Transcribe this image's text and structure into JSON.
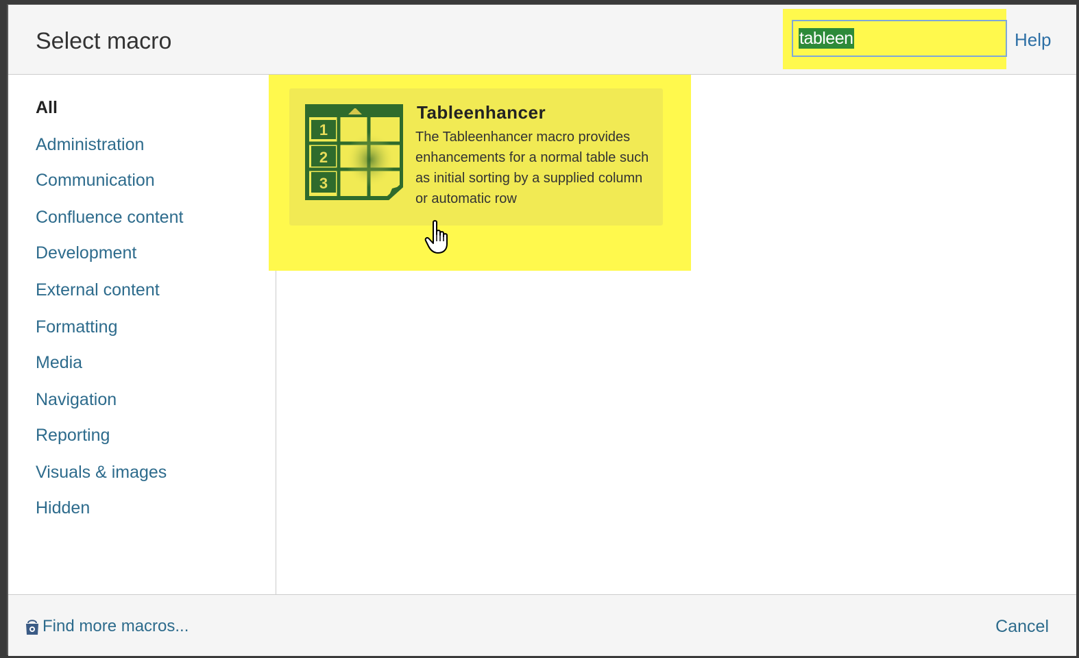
{
  "dialog": {
    "title": "Select macro",
    "help_label": "Help"
  },
  "search": {
    "value": "tableen"
  },
  "sidebar": {
    "items": [
      {
        "label": "All",
        "active": true
      },
      {
        "label": "Administration"
      },
      {
        "label": "Communication"
      },
      {
        "label": "Confluence content"
      },
      {
        "label": "Development"
      },
      {
        "label": "External content"
      },
      {
        "label": "Formatting"
      },
      {
        "label": "Media"
      },
      {
        "label": "Navigation"
      },
      {
        "label": "Reporting"
      },
      {
        "label": "Visuals & images"
      },
      {
        "label": "Hidden"
      }
    ]
  },
  "results": [
    {
      "name": "Tableenhancer",
      "description": "The Tableenhancer macro provides enhancements for a normal table such as initial sorting by a supplied column or automatic row",
      "icon": "table-icon",
      "icon_numbers": [
        "1",
        "2",
        "3"
      ]
    }
  ],
  "footer": {
    "find_more_label": "Find more macros...",
    "cancel_label": "Cancel"
  },
  "colors": {
    "highlight": "#fff94d",
    "link": "#2d6b8c",
    "icon_green": "#2f6b2c",
    "selection_green": "#2d8a39"
  },
  "icons": {
    "cursor": "hand-pointer-icon",
    "find_more": "marketplace-bag-icon"
  }
}
